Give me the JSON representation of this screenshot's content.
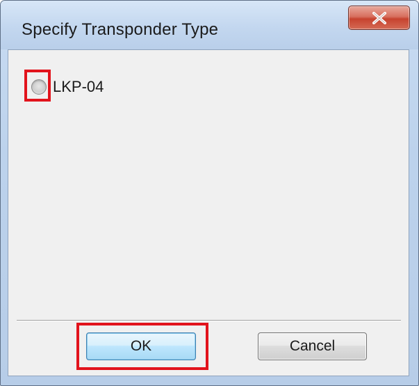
{
  "dialog": {
    "title": "Specify Transponder Type",
    "close_icon": "close-x-icon"
  },
  "options": [
    {
      "label": "LKP-04",
      "selected": false
    }
  ],
  "buttons": {
    "ok_label": "OK",
    "cancel_label": "Cancel"
  },
  "annotations": {
    "highlight_color": "#e2131c",
    "highlighted": [
      "LKP-04 radio",
      "OK button"
    ]
  }
}
